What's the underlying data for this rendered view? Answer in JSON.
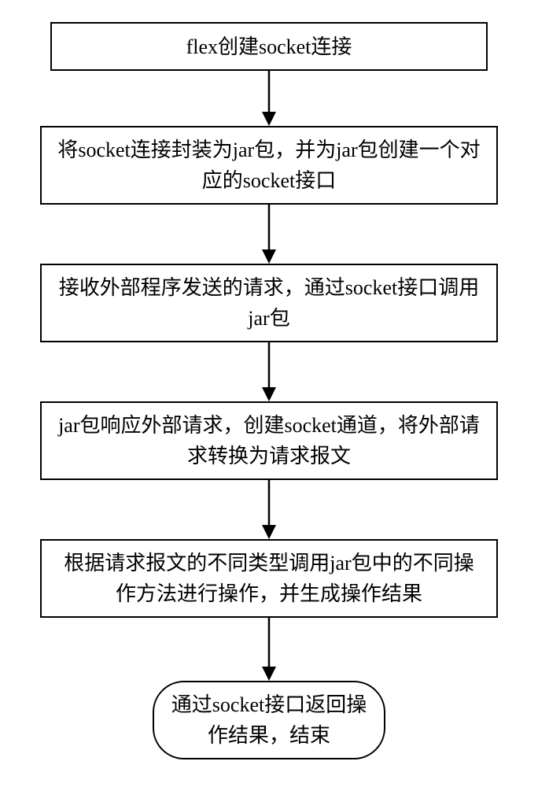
{
  "steps": {
    "s1": "flex创建socket连接",
    "s2": "将socket连接封装为jar包，并为jar包创建一个对应的socket接口",
    "s3": "接收外部程序发送的请求，通过socket接口调用jar包",
    "s4": "jar包响应外部请求，创建socket通道，将外部请求转换为请求报文",
    "s5": "根据请求报文的不同类型调用jar包中的不同操作方法进行操作，并生成操作结果",
    "s6": "通过socket接口返回操作结果，结束"
  }
}
